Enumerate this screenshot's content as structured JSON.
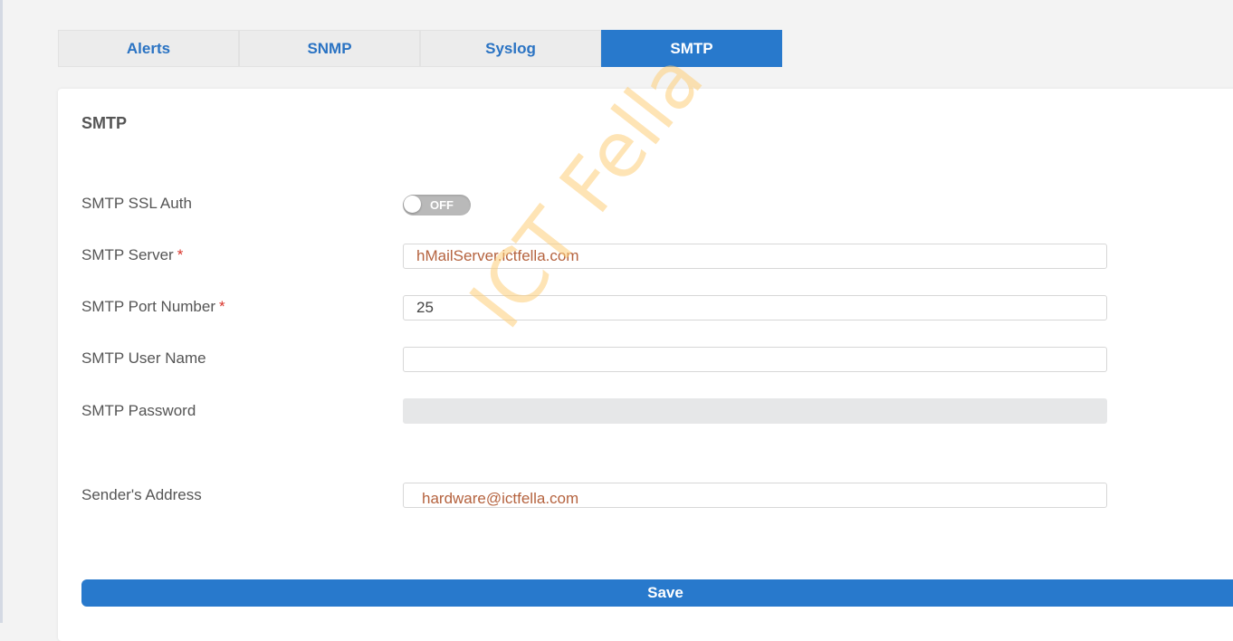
{
  "tabs": [
    {
      "label": "Alerts",
      "active": false
    },
    {
      "label": "SNMP",
      "active": false
    },
    {
      "label": "Syslog",
      "active": false
    },
    {
      "label": "SMTP",
      "active": true
    }
  ],
  "panel": {
    "title": "SMTP"
  },
  "form": {
    "ssl_auth": {
      "label": "SMTP SSL Auth",
      "toggle_text": "OFF",
      "enabled": false
    },
    "server": {
      "label": "SMTP Server",
      "required_mark": "*",
      "value": "hMailServer.ictfella.com"
    },
    "port": {
      "label": "SMTP Port Number",
      "required_mark": "*",
      "value": "25"
    },
    "username": {
      "label": "SMTP User Name",
      "value": ""
    },
    "password": {
      "label": "SMTP Password",
      "value": ""
    },
    "sender": {
      "label": "Sender's Address",
      "value": "hardware@ictfella.com"
    }
  },
  "save_label": "Save",
  "watermark": "ICT Fella",
  "colors": {
    "accent": "#2879cc",
    "tab_text": "#2a73c3",
    "required": "#d9342b",
    "watermark": "#fdcd78"
  }
}
